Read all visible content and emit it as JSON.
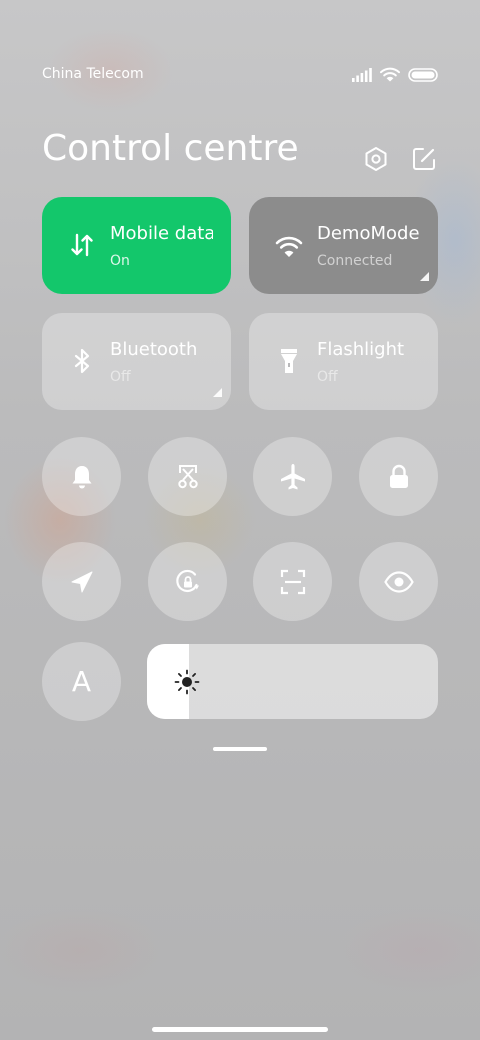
{
  "status_bar": {
    "carrier": "China Telecom",
    "icons": [
      "signal-icon",
      "wifi-icon",
      "battery-icon"
    ]
  },
  "header": {
    "title": "Control centre",
    "icons": [
      "settings-icon",
      "edit-icon"
    ]
  },
  "tiles": [
    {
      "label": "Mobile data",
      "status": "On",
      "icon": "mobile-data-icon",
      "state": "active",
      "color": "#13c76b"
    },
    {
      "label": "DemoMode",
      "status": "Connected",
      "icon": "wifi-icon",
      "state": "connected",
      "color": "#8c8c8c"
    },
    {
      "label": "Bluetooth",
      "status": "Off",
      "icon": "bluetooth-icon",
      "state": "off"
    },
    {
      "label": "Flashlight",
      "status": "Off",
      "icon": "flashlight-icon",
      "state": "off"
    }
  ],
  "toggles": [
    {
      "icon": "bell-icon"
    },
    {
      "icon": "screenshot-icon"
    },
    {
      "icon": "airplane-icon"
    },
    {
      "icon": "lock-icon"
    },
    {
      "icon": "location-icon"
    },
    {
      "icon": "rotation-lock-icon"
    },
    {
      "icon": "scan-icon"
    },
    {
      "icon": "eye-icon"
    }
  ],
  "font_toggle": {
    "label": "A",
    "icon": "font-icon"
  },
  "brightness": {
    "level": 0.145,
    "icon": "sun-icon"
  },
  "colors": {
    "accent_green": "#13c76b",
    "wifi_tile": "#8c8c8c",
    "inactive_tile": "rgba(255,255,255,0.30)"
  }
}
